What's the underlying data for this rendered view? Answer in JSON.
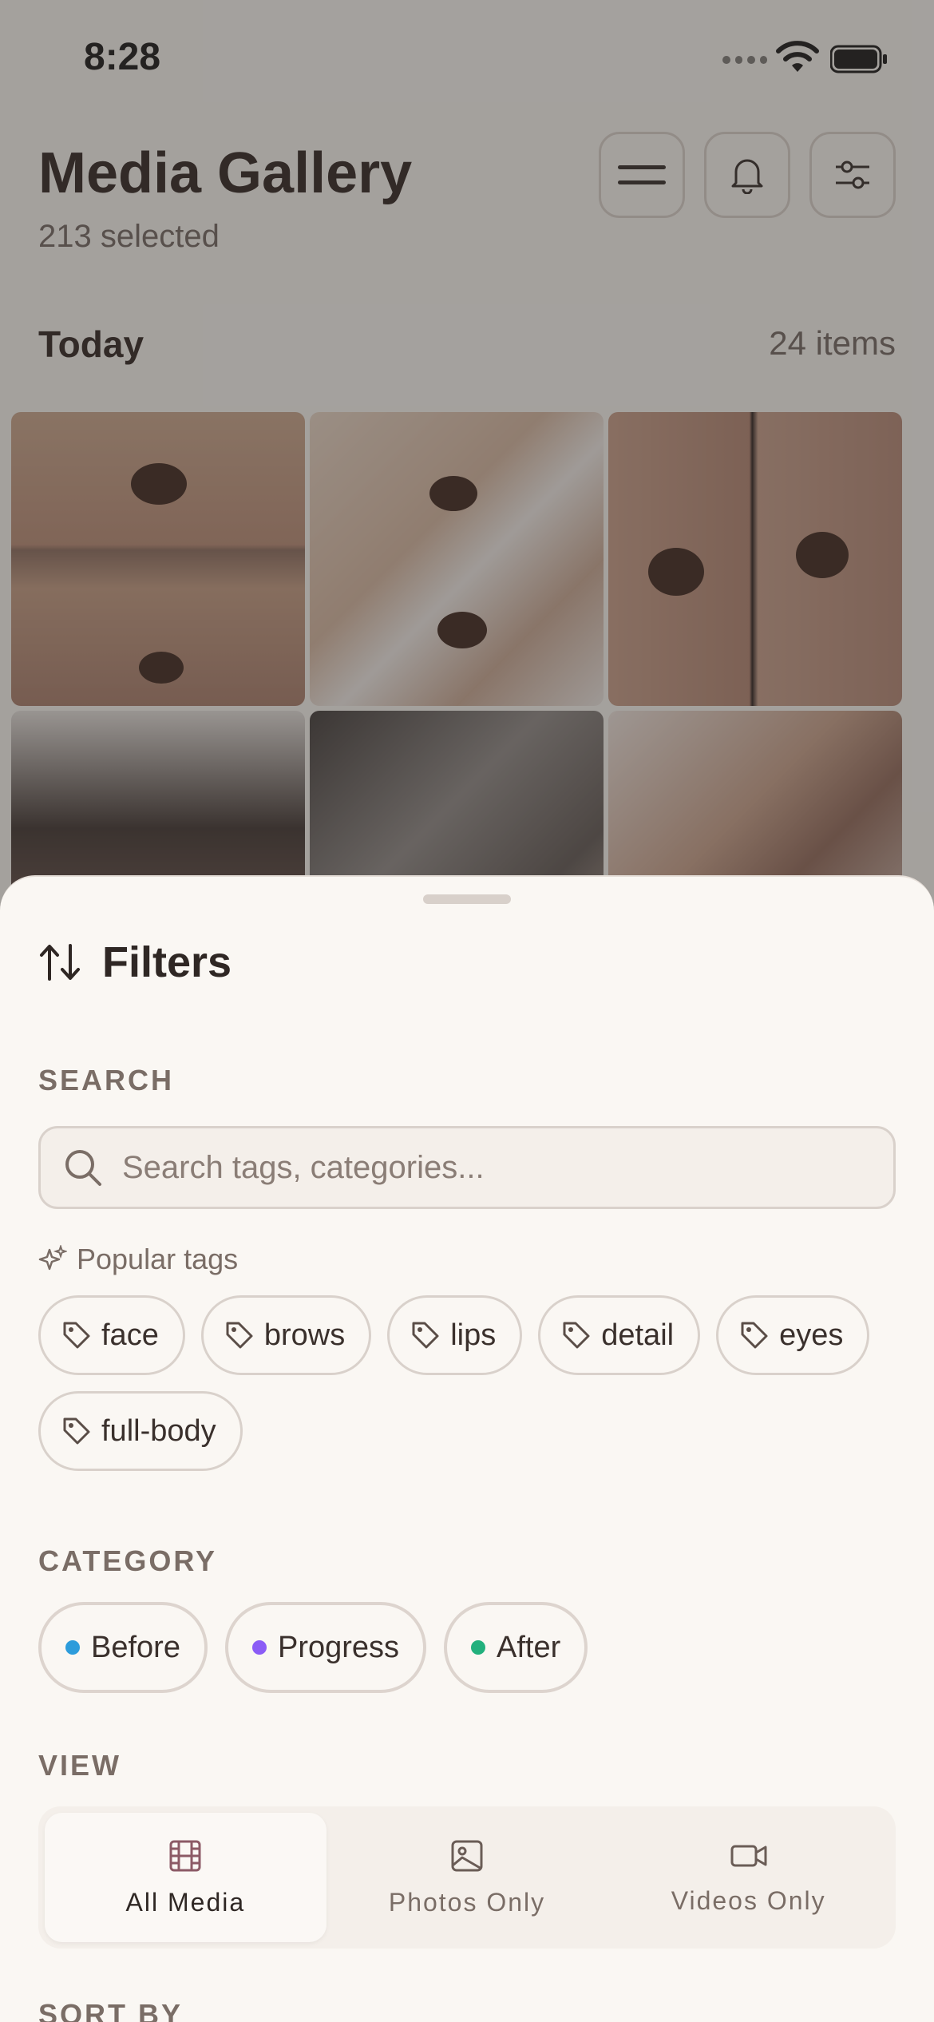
{
  "status_bar": {
    "time": "8:28"
  },
  "header": {
    "title": "Media Gallery",
    "subtitle": "213 selected"
  },
  "section": {
    "title": "Today",
    "count": "24 items"
  },
  "sheet": {
    "title": "Filters",
    "search_label": "SEARCH",
    "search_placeholder": "Search tags, categories...",
    "popular_label": "Popular tags",
    "tags": [
      "face",
      "brows",
      "lips",
      "detail",
      "eyes",
      "full-body"
    ],
    "category_label": "CATEGORY",
    "categories": [
      {
        "label": "Before",
        "color": "#2d9cdb"
      },
      {
        "label": "Progress",
        "color": "#8b5cf6"
      },
      {
        "label": "After",
        "color": "#22b07d"
      }
    ],
    "view_label": "VIEW",
    "view_options": [
      {
        "label": "All Media",
        "icon": "film-icon",
        "active": true
      },
      {
        "label": "Photos Only",
        "icon": "image-icon",
        "active": false
      },
      {
        "label": "Videos Only",
        "icon": "video-icon",
        "active": false
      }
    ],
    "sort_label": "SORT BY"
  },
  "colors": {
    "accent": "#8c5a66",
    "sheet_bg": "#faf7f3",
    "border": "#d9d1cb"
  }
}
